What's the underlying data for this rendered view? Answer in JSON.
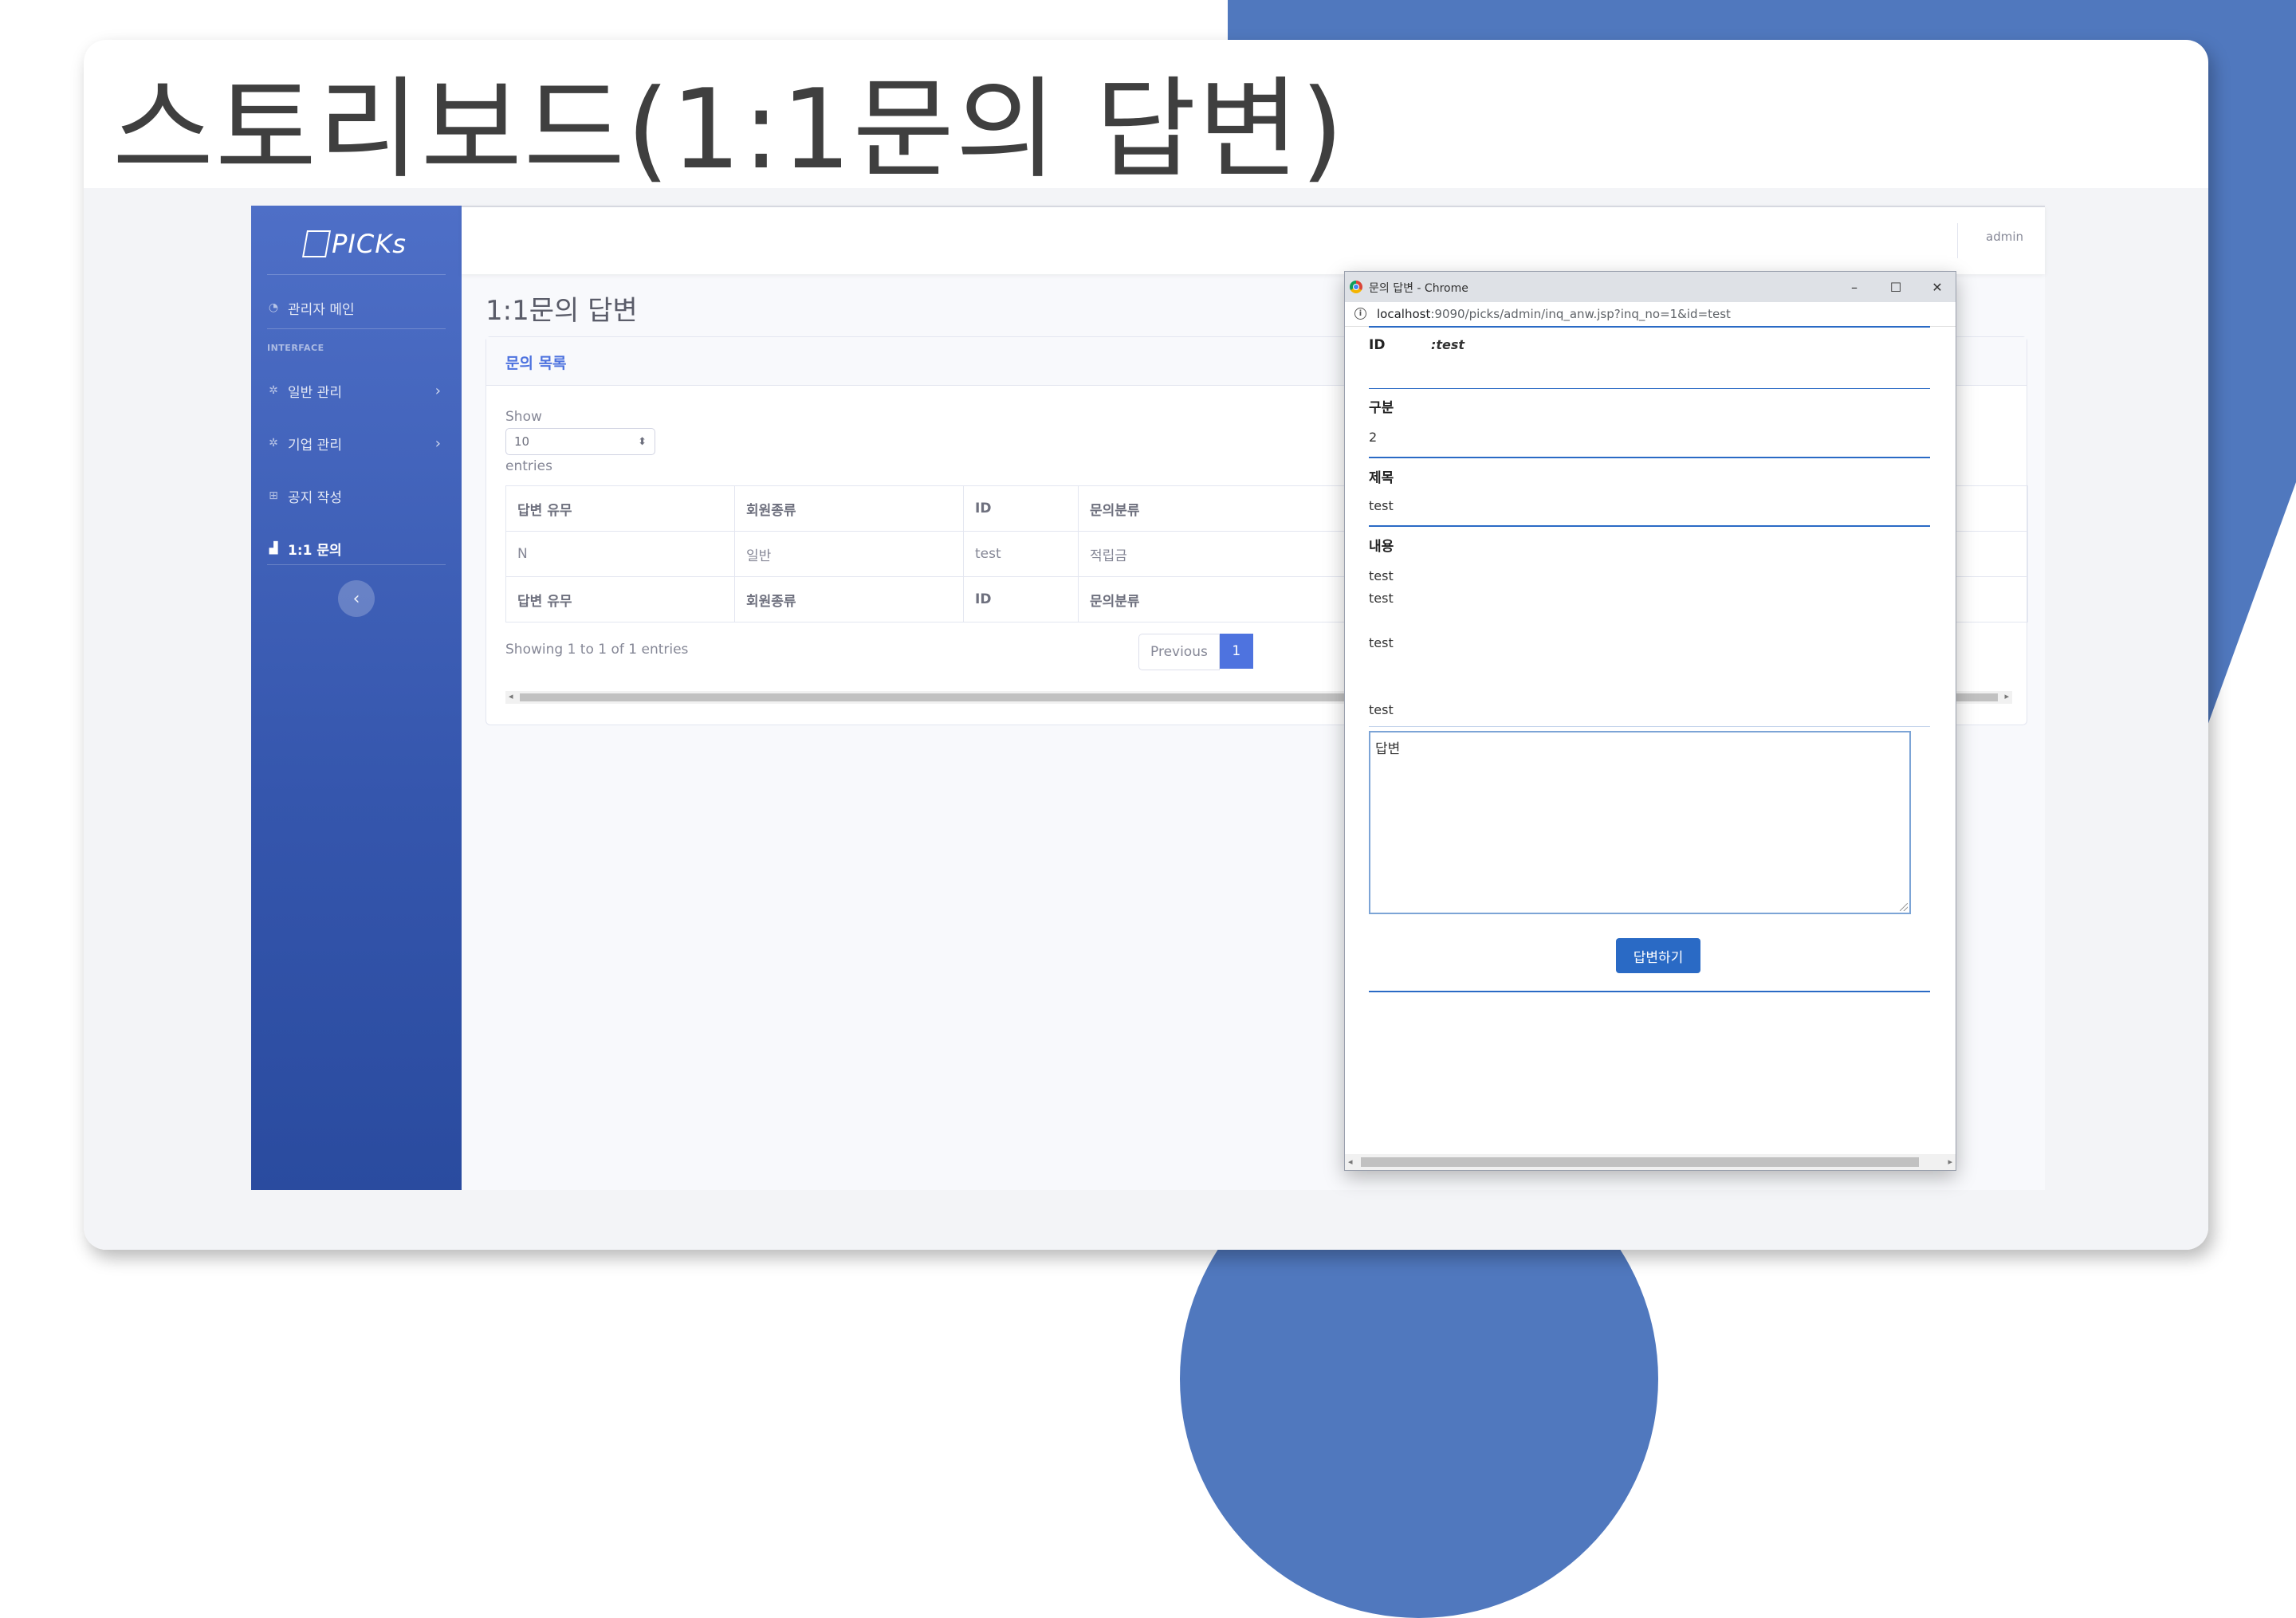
{
  "slide": {
    "title": "스토리보드(1:1문의 답변)",
    "accent_color": "#5078be"
  },
  "admin": {
    "brand": "PICKs",
    "sidebar": {
      "main_item": "관리자 메인",
      "heading": "INTERFACE",
      "items": [
        {
          "label": "일반 관리",
          "icon": "gear-icon"
        },
        {
          "label": "기업 관리",
          "icon": "gear-icon"
        },
        {
          "label": "공지 작성",
          "icon": "table-icon"
        },
        {
          "label": "1:1 문의",
          "icon": "chart-icon"
        }
      ],
      "toggle_icon": "chevron-left-icon"
    },
    "topbar": {
      "user": "admin"
    },
    "page_heading": "1:1문의 답변",
    "card": {
      "title": "문의 목록",
      "show_label": "Show",
      "length_value": "10",
      "entries_label": "entries",
      "columns": [
        "답변 유무",
        "회원종류",
        "ID",
        "문의분류"
      ],
      "rows": [
        [
          "N",
          "일반",
          "test",
          "적립금"
        ]
      ],
      "footer": [
        "답변 유무",
        "회원종류",
        "ID",
        "문의분류"
      ],
      "info": "Showing 1 to 1 of 1 entries",
      "previous": "Previous",
      "page": "1"
    }
  },
  "popup": {
    "window_title": "문의 답변 - Chrome",
    "url_host": "localhost",
    "url_rest": ":9090/picks/admin/inq_anw.jsp?inq_no=1&id=test",
    "id_label": "ID",
    "id_value": ":test",
    "category_label": "구분",
    "category_value": "2",
    "subject_label": "제목",
    "subject_value": "test",
    "content_label": "내용",
    "content_lines": [
      "test",
      "test",
      "test",
      "test"
    ],
    "answer_placeholder": "답변",
    "submit": "답변하기"
  }
}
